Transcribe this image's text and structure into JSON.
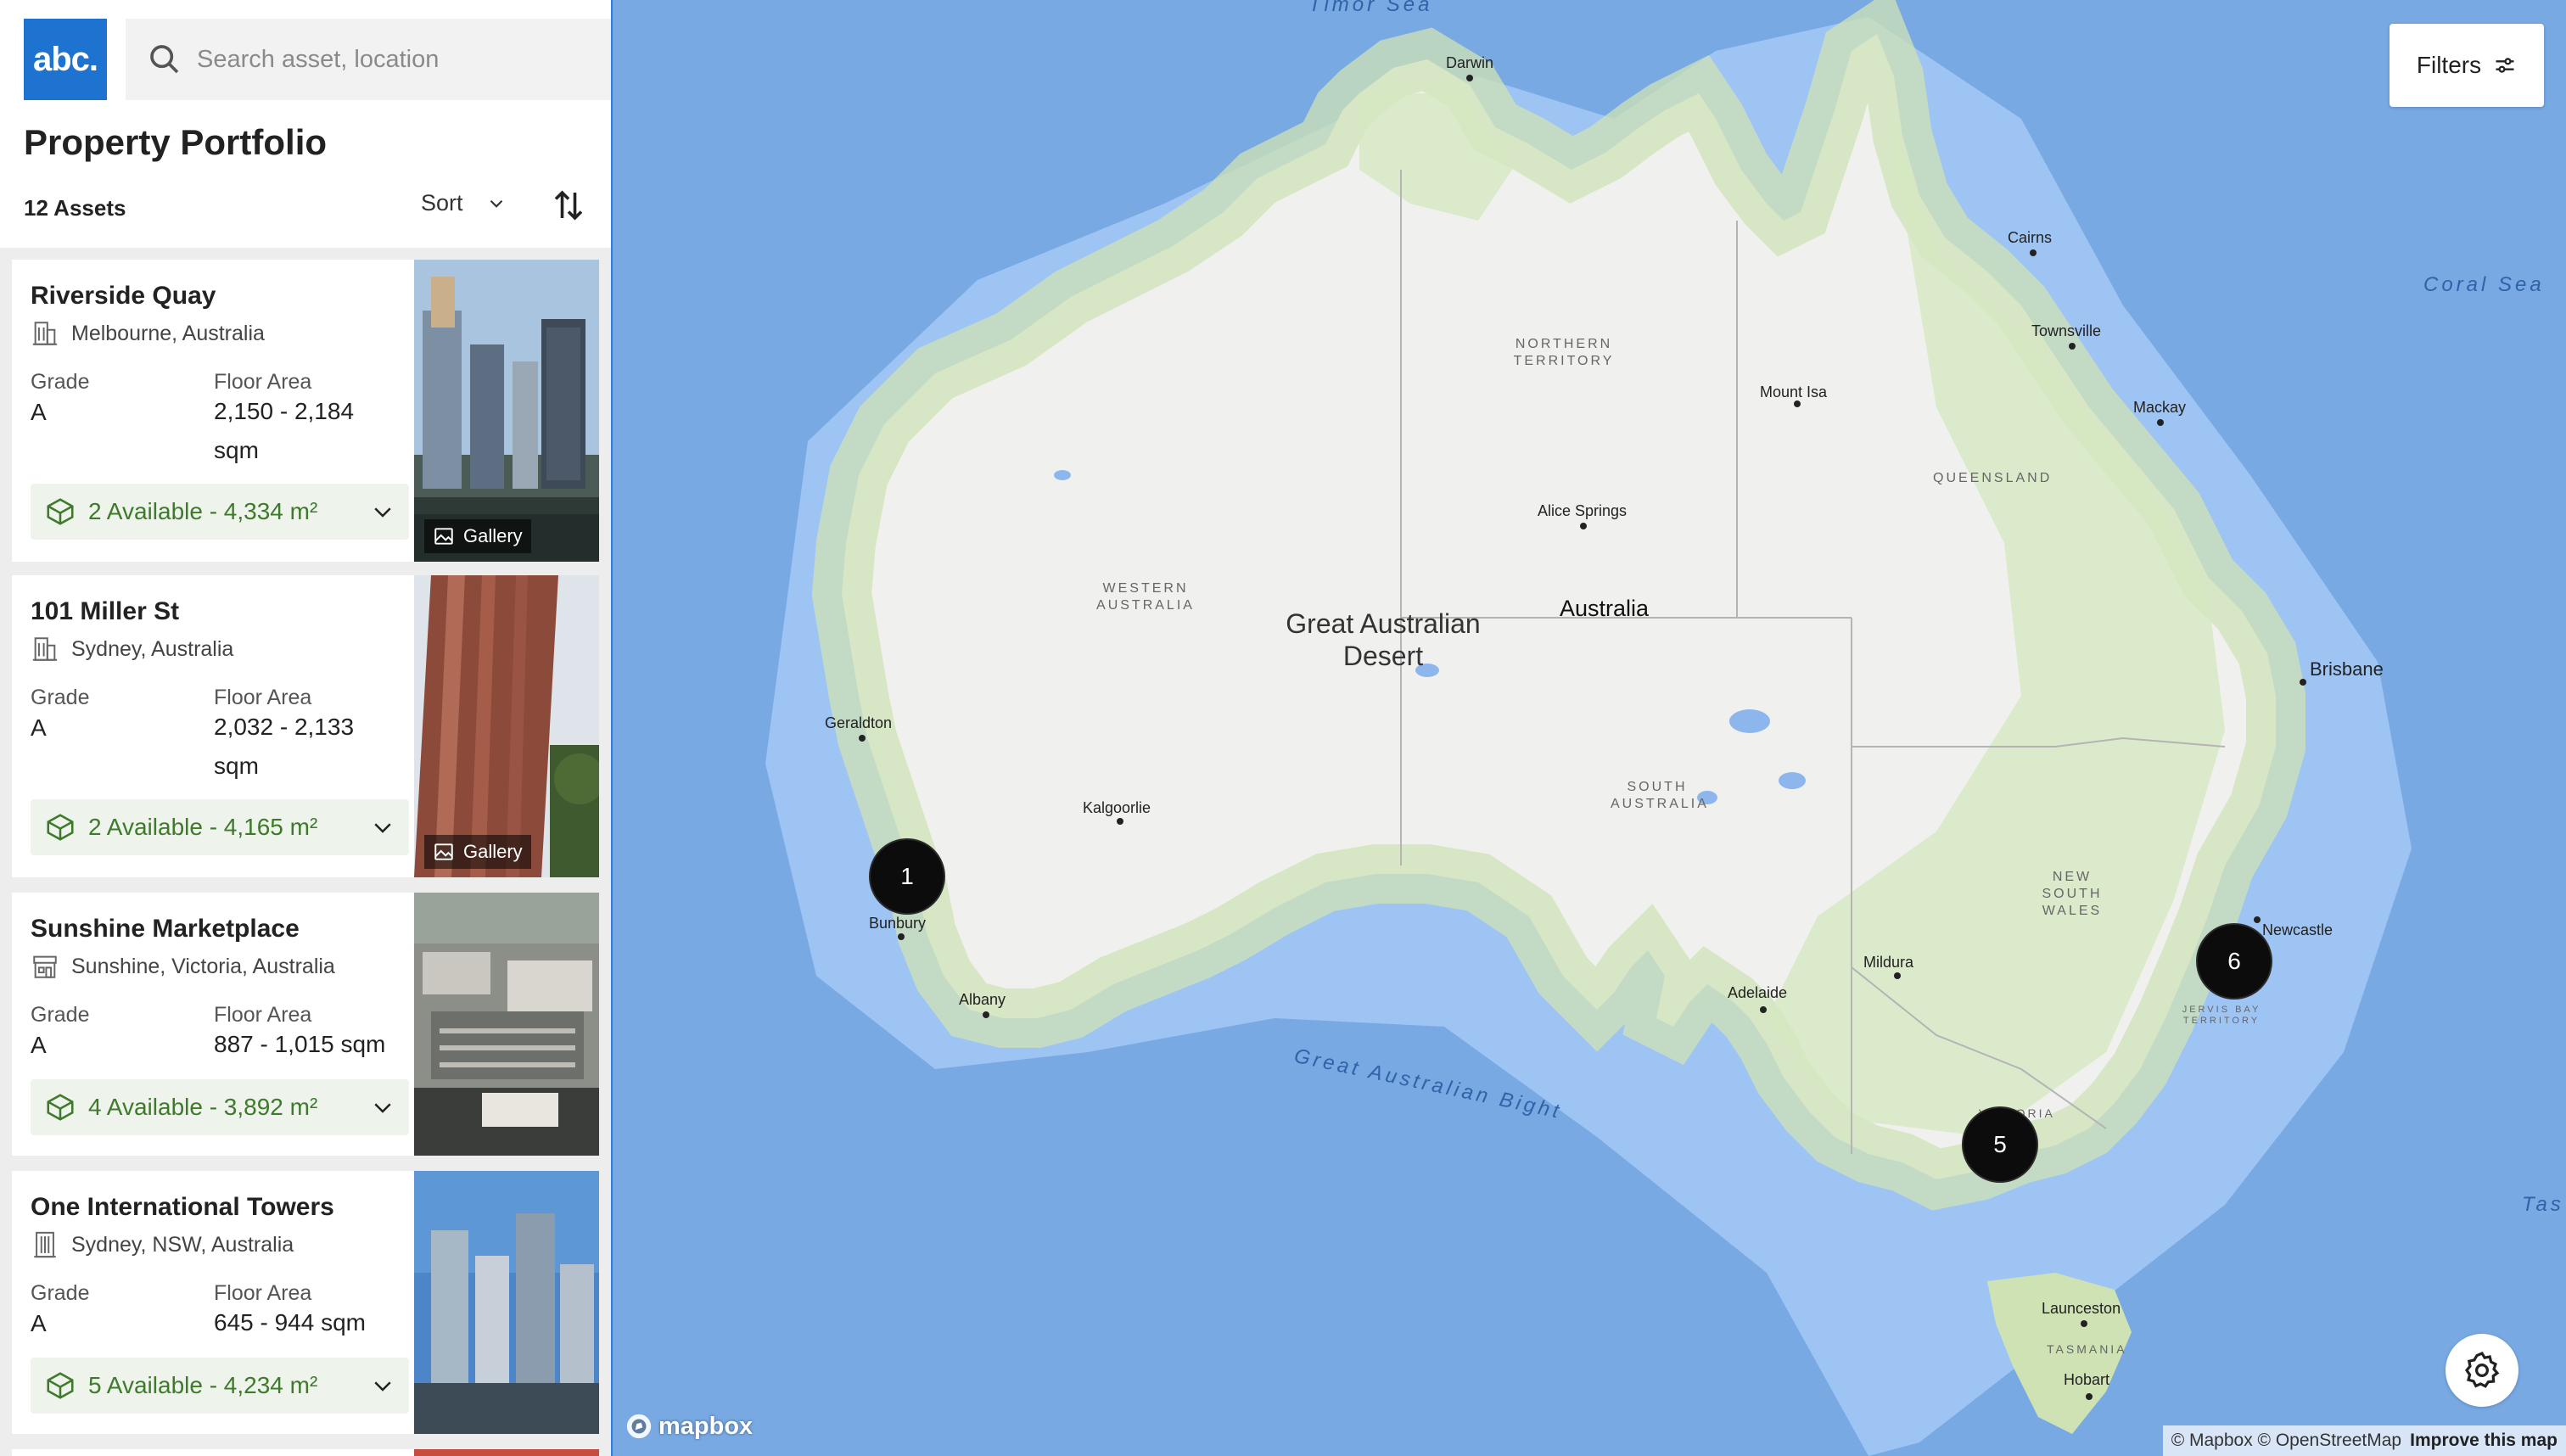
{
  "app": {
    "logo_text": "abc.",
    "search": {
      "placeholder": "Search asset, location"
    },
    "page_title": "Property Portfolio",
    "asset_count": "12 Assets",
    "sort_label": "Sort"
  },
  "labels": {
    "grade": "Grade",
    "floor_area": "Floor Area",
    "gallery": "Gallery"
  },
  "cards": [
    {
      "title": "Riverside Quay",
      "location": "Melbourne, Australia",
      "grade": "A",
      "floor_area": "2,150 - 2,184 sqm",
      "availability": "2 Available - 4,334 m²",
      "location_icon": "office-building-icon",
      "media": "gallery"
    },
    {
      "title": "101 Miller St",
      "location": "Sydney, Australia",
      "grade": "A",
      "floor_area": "2,032 - 2,133 sqm",
      "availability": "2 Available - 4,165 m²",
      "location_icon": "office-building-icon",
      "media": "gallery"
    },
    {
      "title": "Sunshine Marketplace",
      "location": "Sunshine, Victoria, Australia",
      "grade": "A",
      "floor_area": "887 - 1,015 sqm",
      "availability": "4 Available - 3,892 m²",
      "location_icon": "shop-icon",
      "media": "360 + image"
    },
    {
      "title": "One International Towers",
      "location": "Sydney, NSW, Australia",
      "grade": "A",
      "floor_area": "645 - 944 sqm",
      "availability": "5 Available - 4,234 m²",
      "location_icon": "tower-icon",
      "media": "3d + 360 + image"
    }
  ],
  "map": {
    "filters_label": "Filters",
    "clusters": [
      "1",
      "6",
      "5"
    ],
    "labels": {
      "timor_sea": "Timor Sea",
      "coral_sea": "Coral Sea",
      "tasman": "Tas",
      "bight": "Great Australian Bight",
      "desert": "Great Australian Desert",
      "country": "Australia",
      "northern_territory": "NORTHERN TERRITORY",
      "western_australia": "WESTERN AUSTRALIA",
      "queensland": "QUEENSLAND",
      "south_australia": "SOUTH AUSTRALIA",
      "new_south_wales": "NEW SOUTH WALES",
      "victoria": "VICTORIA",
      "tasmania": "TASMANIA",
      "jervis_bay": "JERVIS BAY TERRITORY"
    },
    "cities": {
      "darwin": "Darwin",
      "cairns": "Cairns",
      "townsville": "Townsville",
      "mackay": "Mackay",
      "mount_isa": "Mount Isa",
      "alice_springs": "Alice Springs",
      "brisbane": "Brisbane",
      "geraldton": "Geraldton",
      "kalgoorlie": "Kalgoorlie",
      "bunbury": "Bunbury",
      "albany": "Albany",
      "adelaide": "Adelaide",
      "mildura": "Mildura",
      "newcastle": "Newcastle",
      "launceston": "Launceston",
      "hobart": "Hobart"
    },
    "mapbox_logo": "mapbox",
    "attribution": "© Mapbox © OpenStreetMap",
    "improve": "Improve this map"
  }
}
